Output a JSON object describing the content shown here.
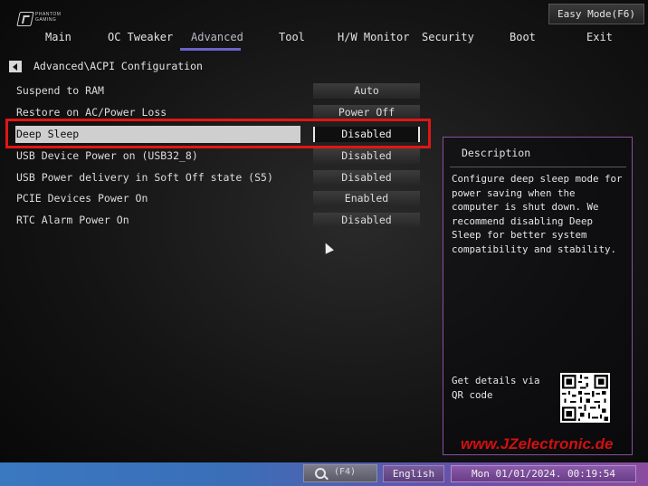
{
  "header": {
    "logo_line1": "PHANTOM",
    "logo_line2": "GAMING",
    "easy_mode_label": "Easy Mode(F6)"
  },
  "menu": {
    "items": [
      {
        "label": "Main"
      },
      {
        "label": "OC Tweaker"
      },
      {
        "label": "Advanced",
        "active": true
      },
      {
        "label": "Tool"
      },
      {
        "label": "H/W Monitor"
      },
      {
        "label": "Security"
      },
      {
        "label": "Boot"
      },
      {
        "label": "Exit"
      }
    ]
  },
  "breadcrumb": {
    "path": "Advanced\\ACPI Configuration"
  },
  "settings": [
    {
      "label": "Suspend to RAM",
      "value": "Auto"
    },
    {
      "label": "Restore on AC/Power Loss",
      "value": "Power Off"
    },
    {
      "label": "Deep Sleep",
      "value": "Disabled",
      "selected": true
    },
    {
      "label": "USB Device Power on (USB32_8)",
      "value": "Disabled"
    },
    {
      "label": "USB Power delivery in Soft Off state (S5)",
      "value": "Disabled"
    },
    {
      "label": "PCIE Devices Power On",
      "value": "Enabled"
    },
    {
      "label": "RTC Alarm Power On",
      "value": "Disabled"
    }
  ],
  "description": {
    "title": "Description",
    "body": "Configure deep sleep mode for power saving when the computer is shut down. We recommend disabling Deep Sleep for better system compatibility and stability.",
    "qr_label": "Get details via QR code"
  },
  "watermark": "www.JZelectronic.de",
  "footer": {
    "search_key": "(F4)",
    "language": "English",
    "datetime": "Mon 01/01/2024. 00:19:54"
  },
  "colors": {
    "accent": "#6b63c8",
    "highlight_box": "#e01616",
    "panel_border": "#8a4f9e"
  },
  "icons": [
    "back-arrow-icon",
    "search-icon",
    "qr-code-icon",
    "mouse-cursor-icon",
    "brand-logo-icon"
  ]
}
